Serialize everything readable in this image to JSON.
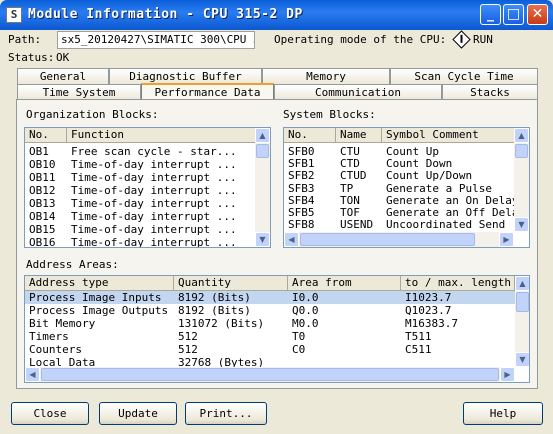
{
  "window": {
    "title": "Module Information - CPU 315-2 DP",
    "icon_letter": "S"
  },
  "path": {
    "label": "Path:",
    "value": "sx5_20120427\\SIMATIC 300\\CPU 315",
    "mode_label": "Operating mode of the  CPU:",
    "mode_value": "RUN"
  },
  "status": {
    "label": "Status:",
    "value": "OK"
  },
  "tabs": {
    "row1": [
      "General",
      "Diagnostic Buffer",
      "Memory",
      "Scan Cycle Time"
    ],
    "row2": [
      "Time System",
      "Performance Data",
      "Communication",
      "Stacks"
    ],
    "active": "Performance Data"
  },
  "org_blocks": {
    "heading": "Organization Blocks:",
    "columns": [
      "No.",
      "Function"
    ],
    "rows": [
      [
        "OB1",
        "Free scan cycle   - star..."
      ],
      [
        "OB10",
        "Time-of-day interrupt    ..."
      ],
      [
        "OB11",
        "Time-of-day interrupt    ..."
      ],
      [
        "OB12",
        "Time-of-day interrupt    ..."
      ],
      [
        "OB13",
        "Time-of-day interrupt    ..."
      ],
      [
        "OB14",
        "Time-of-day interrupt    ..."
      ],
      [
        "OB15",
        "Time-of-day interrupt    ..."
      ],
      [
        "OB16",
        "Time-of-day interrupt    ..."
      ]
    ]
  },
  "system_blocks": {
    "heading": "System Blocks:",
    "columns": [
      "No.",
      "Name",
      "Symbol Comment"
    ],
    "rows": [
      [
        "SFB0",
        "CTU",
        "Count Up"
      ],
      [
        "SFB1",
        "CTD",
        "Count Down"
      ],
      [
        "SFB2",
        "CTUD",
        "Count Up/Down"
      ],
      [
        "SFB3",
        "TP",
        "Generate a Pulse"
      ],
      [
        "SFB4",
        "TON",
        "Generate an On Delay"
      ],
      [
        "SFB5",
        "TOF",
        "Generate an Off Delay"
      ],
      [
        "SFB8",
        "USEND",
        "Uncoordinated Send"
      ]
    ]
  },
  "address_areas": {
    "heading": "Address Areas:",
    "columns": [
      "Address type",
      "Quantity",
      "Area from",
      "to / max. length"
    ],
    "rows": [
      [
        "Process Image Inputs",
        "8192 (Bits)",
        "I0.0",
        "I1023.7"
      ],
      [
        "Process Image Outputs",
        "8192 (Bits)",
        "Q0.0",
        "Q1023.7"
      ],
      [
        "Bit Memory",
        "131072 (Bits)",
        "M0.0",
        "M16383.7"
      ],
      [
        "Timers",
        "512",
        "T0",
        "T511"
      ],
      [
        "Counters",
        "512",
        "C0",
        "C511"
      ],
      [
        "Local Data",
        "32768 (Bytes)",
        "",
        ""
      ]
    ]
  },
  "buttons": {
    "close": "Close",
    "update": "Update",
    "print": "Print...",
    "help": "Help"
  }
}
